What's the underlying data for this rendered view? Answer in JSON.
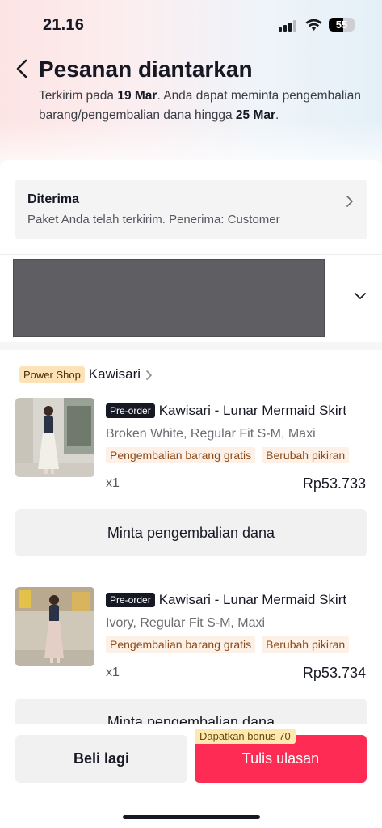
{
  "status_bar": {
    "time": "21.16",
    "battery": "55"
  },
  "header": {
    "title": "Pesanan diantarkan",
    "subtitle_parts": {
      "p1": "Terkirim pada ",
      "date_sent": "19 Mar",
      "p2": ". Anda dapat meminta pengembalian barang/pengembalian dana hingga ",
      "date_deadline": "25 Mar",
      "p3": "."
    }
  },
  "delivery": {
    "title": "Diterima",
    "description": "Paket Anda telah terkirim. Penerima: Customer"
  },
  "shop": {
    "badge": "Power Shop",
    "name": "Kawisari"
  },
  "products": [
    {
      "badge": "Pre-order",
      "title": "Kawisari - Lunar Mermaid Skirt",
      "variant": "Broken White, Regular Fit S-M, Maxi",
      "tags": [
        "Pengembalian barang gratis",
        "Berubah pikiran"
      ],
      "qty": "x1",
      "price": "Rp53.733",
      "refund_label": "Minta pengembalian dana",
      "skirt_color": "#f2efe8"
    },
    {
      "badge": "Pre-order",
      "title": "Kawisari - Lunar Mermaid Skirt",
      "variant": "Ivory, Regular Fit S-M, Maxi",
      "tags": [
        "Pengembalian barang gratis",
        "Berubah pikiran"
      ],
      "qty": "x1",
      "price": "Rp53.734",
      "refund_label": "Minta pengembalian dana",
      "skirt_color": "#e3cfc6"
    }
  ],
  "bottom": {
    "buy_again": "Beli lagi",
    "review": "Tulis ulasan",
    "bonus": "Dapatkan bonus 70"
  },
  "colors": {
    "accent": "#fe2c55",
    "text": "#161823"
  }
}
